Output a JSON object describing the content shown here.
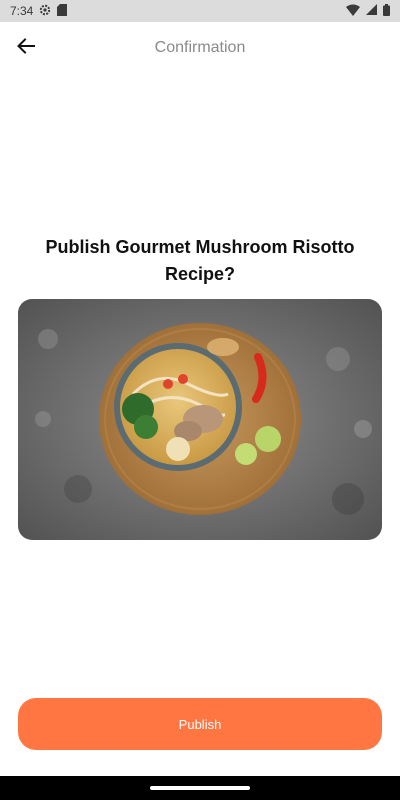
{
  "status_bar": {
    "time": "7:34",
    "icons": [
      "gear-icon",
      "sd-card-icon",
      "wifi-icon",
      "signal-icon",
      "battery-icon"
    ]
  },
  "app_bar": {
    "title": "Confirmation",
    "back_icon": "arrow-left-icon"
  },
  "main": {
    "headline_line1": "Publish Gourmet Mushroom Risotto",
    "headline_line2": "Recipe?",
    "image_description_icon": "food-photo"
  },
  "actions": {
    "publish_label": "Publish"
  },
  "colors": {
    "accent": "#ff7642",
    "status_bar_bg": "#dcdcdc",
    "nav_bar_bg": "#000000"
  }
}
